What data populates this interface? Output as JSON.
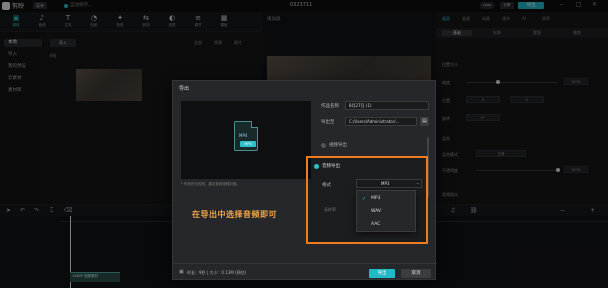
{
  "titlebar": {
    "app_name": "剪映",
    "menu": "菜单",
    "autosave": "自动保存...",
    "window_title": "0323711",
    "upgrade": "Lyaa",
    "share": "分享",
    "export": "导出",
    "minimize": "–",
    "maximize": "□",
    "close": "✕"
  },
  "toolbar": {
    "tools": [
      {
        "icon": "▣",
        "label": "媒体",
        "active": true
      },
      {
        "icon": "♪",
        "label": "音频"
      },
      {
        "icon": "T",
        "label": "文本"
      },
      {
        "icon": "◔",
        "label": "贴纸"
      },
      {
        "icon": "✦",
        "label": "特效"
      },
      {
        "icon": "⇆",
        "label": "转场"
      },
      {
        "icon": "◐",
        "label": "滤镜"
      },
      {
        "icon": "≡",
        "label": "调节"
      },
      {
        "icon": "▦",
        "label": "模板"
      }
    ]
  },
  "leftnav": {
    "items": [
      "本地",
      "导入",
      "我的预设",
      "云素材",
      "素材库"
    ]
  },
  "media": {
    "import": "导入",
    "filters": [
      "全部",
      "视频",
      "图片"
    ],
    "section": "8张"
  },
  "player": {
    "title": "播放器"
  },
  "rightpanel": {
    "tabs": [
      "画面",
      "变速",
      "动画",
      "调节",
      "AI",
      "帧率"
    ],
    "subtabs": [
      "基础",
      "抠像",
      "蒙版",
      "美颜"
    ],
    "rows": [
      "位置大小",
      "缩放",
      "位置",
      "旋转",
      "混合",
      "混合模式",
      "不透明度",
      "视频防抖"
    ],
    "scale_val": "100%",
    "mode_val": "正常",
    "opacity_val": "100%",
    "x_val": "0",
    "y_val": "0",
    "rot_val": "0°"
  },
  "timeline": {
    "clip_label": "1080P 视频素材"
  },
  "dialog": {
    "title": "导出",
    "name_label": "作品名称",
    "name_value": "8月27日 (1)",
    "path_label": "导出至",
    "path_value": "C:/Users/Administrator/...",
    "video_export": "视频导出",
    "audio_export": "音频导出",
    "format_label": "格式",
    "format_value": "MP3",
    "rate_label": "采样率",
    "hint": "* 作品时长较短，建议使用视频封面。",
    "footer_info": "时长：9秒 | 大小：0.13M (预估)",
    "ok": "导出",
    "cancel": "取消"
  },
  "preview": {
    "ext": "MP4",
    "badge": "MP4"
  },
  "dropdown": {
    "options": [
      "MP3",
      "WAV",
      "AAC"
    ],
    "selected_index": 0
  },
  "annotation": {
    "text": "在导出中选择音频即可"
  },
  "colors": {
    "accent": "#22b9c6",
    "highlight": "#f07b1e"
  }
}
